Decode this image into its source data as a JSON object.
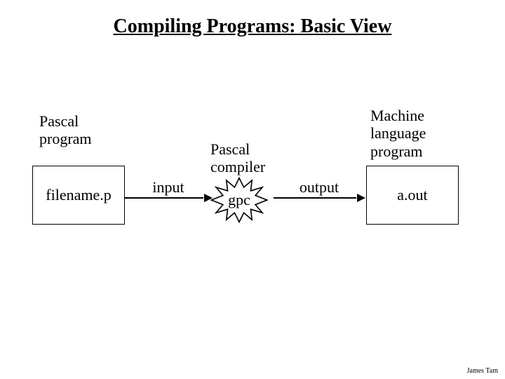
{
  "title": "Compiling Programs: Basic View",
  "left_label": "Pascal\nprogram",
  "left_box": "filename.p",
  "arrow1_label": "input",
  "center_label": "Pascal\ncompiler",
  "center_box": "gpc",
  "arrow2_label": "output",
  "right_label": "Machine\nlanguage\nprogram",
  "right_box": "a.out",
  "footer": "James Tam"
}
